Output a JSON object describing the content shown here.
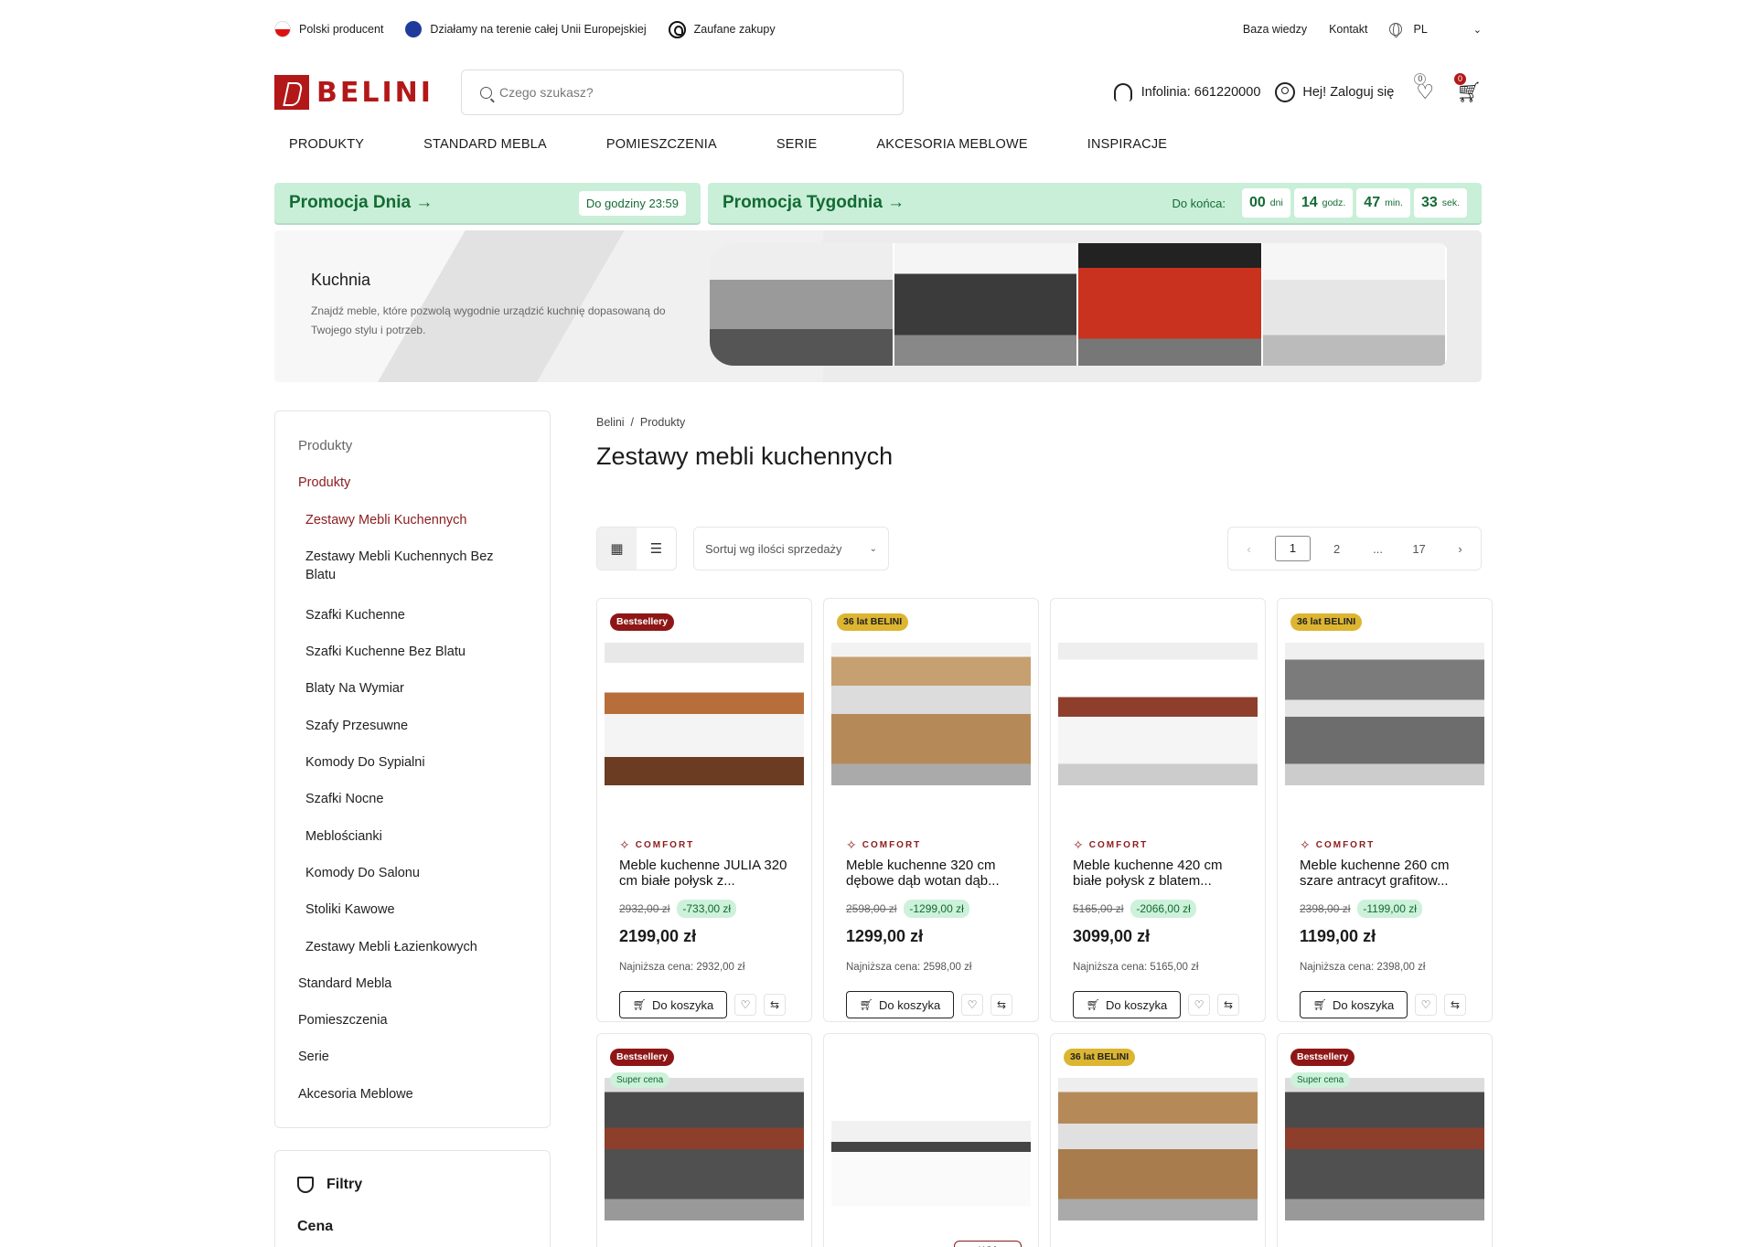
{
  "topbar": {
    "items": [
      "Polski producent",
      "Działamy na terenie całej Unii Europejskiej",
      "Zaufane zakupy"
    ],
    "links": [
      "Baza wiedzy",
      "Kontakt"
    ],
    "lang": "PL"
  },
  "header": {
    "logo": "BELINI",
    "search_placeholder": "Czego szukasz?",
    "infolinia": "Infolinia: 661220000",
    "login": "Hej! Zaloguj się",
    "wishlist_count": "0",
    "cart_count": "0"
  },
  "nav": [
    "PRODUKTY",
    "STANDARD MEBLA",
    "POMIESZCZENIA",
    "SERIE",
    "AKCESORIA MEBLOWE",
    "INSPIRACJE"
  ],
  "promo": {
    "day_title": "Promocja Dnia →",
    "day_until": "Do godziny 23:59",
    "week_title": "Promocja Tygodnia →",
    "week_label": "Do końca:",
    "countdown": [
      {
        "v": "00",
        "u": "dni"
      },
      {
        "v": "14",
        "u": "godz."
      },
      {
        "v": "47",
        "u": "min."
      },
      {
        "v": "33",
        "u": "sek."
      }
    ]
  },
  "hero": {
    "title": "Kuchnia",
    "desc": "Znajdź meble, które pozwolą wygodnie urządzić kuchnię dopasowaną do Twojego stylu i potrzeb."
  },
  "sidebar": {
    "heading": "Produkty",
    "items": [
      {
        "label": "Produkty",
        "cls": "act"
      },
      {
        "label": "Zestawy Mebli Kuchennych",
        "cls": "sub act"
      },
      {
        "label": "Zestawy Mebli Kuchennych Bez Blatu",
        "cls": "sub tall"
      },
      {
        "label": "Szafki Kuchenne",
        "cls": "sub"
      },
      {
        "label": "Szafki Kuchenne Bez Blatu",
        "cls": "sub"
      },
      {
        "label": "Blaty Na Wymiar",
        "cls": "sub"
      },
      {
        "label": "Szafy Przesuwne",
        "cls": "sub"
      },
      {
        "label": "Komody Do Sypialni",
        "cls": "sub"
      },
      {
        "label": "Szafki Nocne",
        "cls": "sub"
      },
      {
        "label": "Meblościanki",
        "cls": "sub"
      },
      {
        "label": "Komody Do Salonu",
        "cls": "sub"
      },
      {
        "label": "Stoliki Kawowe",
        "cls": "sub"
      },
      {
        "label": "Zestawy Mebli Łazienkowych",
        "cls": "sub"
      },
      {
        "label": "Standard Mebla",
        "cls": ""
      },
      {
        "label": "Pomieszczenia",
        "cls": ""
      },
      {
        "label": "Serie",
        "cls": ""
      },
      {
        "label": "Akcesoria Meblowe",
        "cls": ""
      }
    ],
    "filters_title": "Filtry",
    "price_label": "Cena"
  },
  "main": {
    "breadcrumb": "Belini  /  Produkty",
    "title": "Zestawy mebli kuchennych",
    "sort": "Sortuj wg ilości sprzedaży",
    "pages": [
      "‹",
      "1",
      "2",
      "...",
      "17",
      "›"
    ]
  },
  "products": [
    {
      "tag": "Bestsellery",
      "tagc": "bs",
      "brand": "COMFORT",
      "name": "Meble kuchenne JULIA 320 cm białe połysk z...",
      "old": "2932,00 zł",
      "disc": "-733,00 zł",
      "price": "2199,00 zł",
      "low": "Najniższa cena: 2932,00 zł",
      "img": "k1"
    },
    {
      "tag": "36 lat BELINI",
      "tagc": "y",
      "brand": "COMFORT",
      "name": "Meble kuchenne 320 cm dębowe dąb wotan dąb...",
      "old": "2598,00 zł",
      "disc": "-1299,00 zł",
      "price": "1299,00 zł",
      "low": "Najniższa cena: 2598,00 zł",
      "img": "k2"
    },
    {
      "tag": "",
      "tagc": "",
      "brand": "COMFORT",
      "name": "Meble kuchenne 420 cm białe połysk z blatem...",
      "old": "5165,00 zł",
      "disc": "-2066,00 zł",
      "price": "3099,00 zł",
      "low": "Najniższa cena: 5165,00 zł",
      "img": "k3"
    },
    {
      "tag": "36 lat BELINI",
      "tagc": "y",
      "brand": "COMFORT",
      "name": "Meble kuchenne 260 cm szare antracyt grafitow...",
      "old": "2398,00 zł",
      "disc": "-1199,00 zł",
      "price": "1199,00 zł",
      "low": "Najniższa cena: 2398,00 zł",
      "img": "k4"
    }
  ],
  "products_row2": [
    {
      "tag": "Bestsellery",
      "tagc": "bs",
      "tag2": "Super cena",
      "img": "k5"
    },
    {
      "tag": "",
      "tagc": "",
      "tag2": "",
      "img": "k6",
      "video": "Wideo"
    },
    {
      "tag": "36 lat BELINI",
      "tagc": "y",
      "tag2": "",
      "img": "k7"
    },
    {
      "tag": "Bestsellery",
      "tagc": "bs",
      "tag2": "Super cena",
      "img": "k8"
    }
  ],
  "labels": {
    "add_to_cart": "Do koszyka"
  }
}
